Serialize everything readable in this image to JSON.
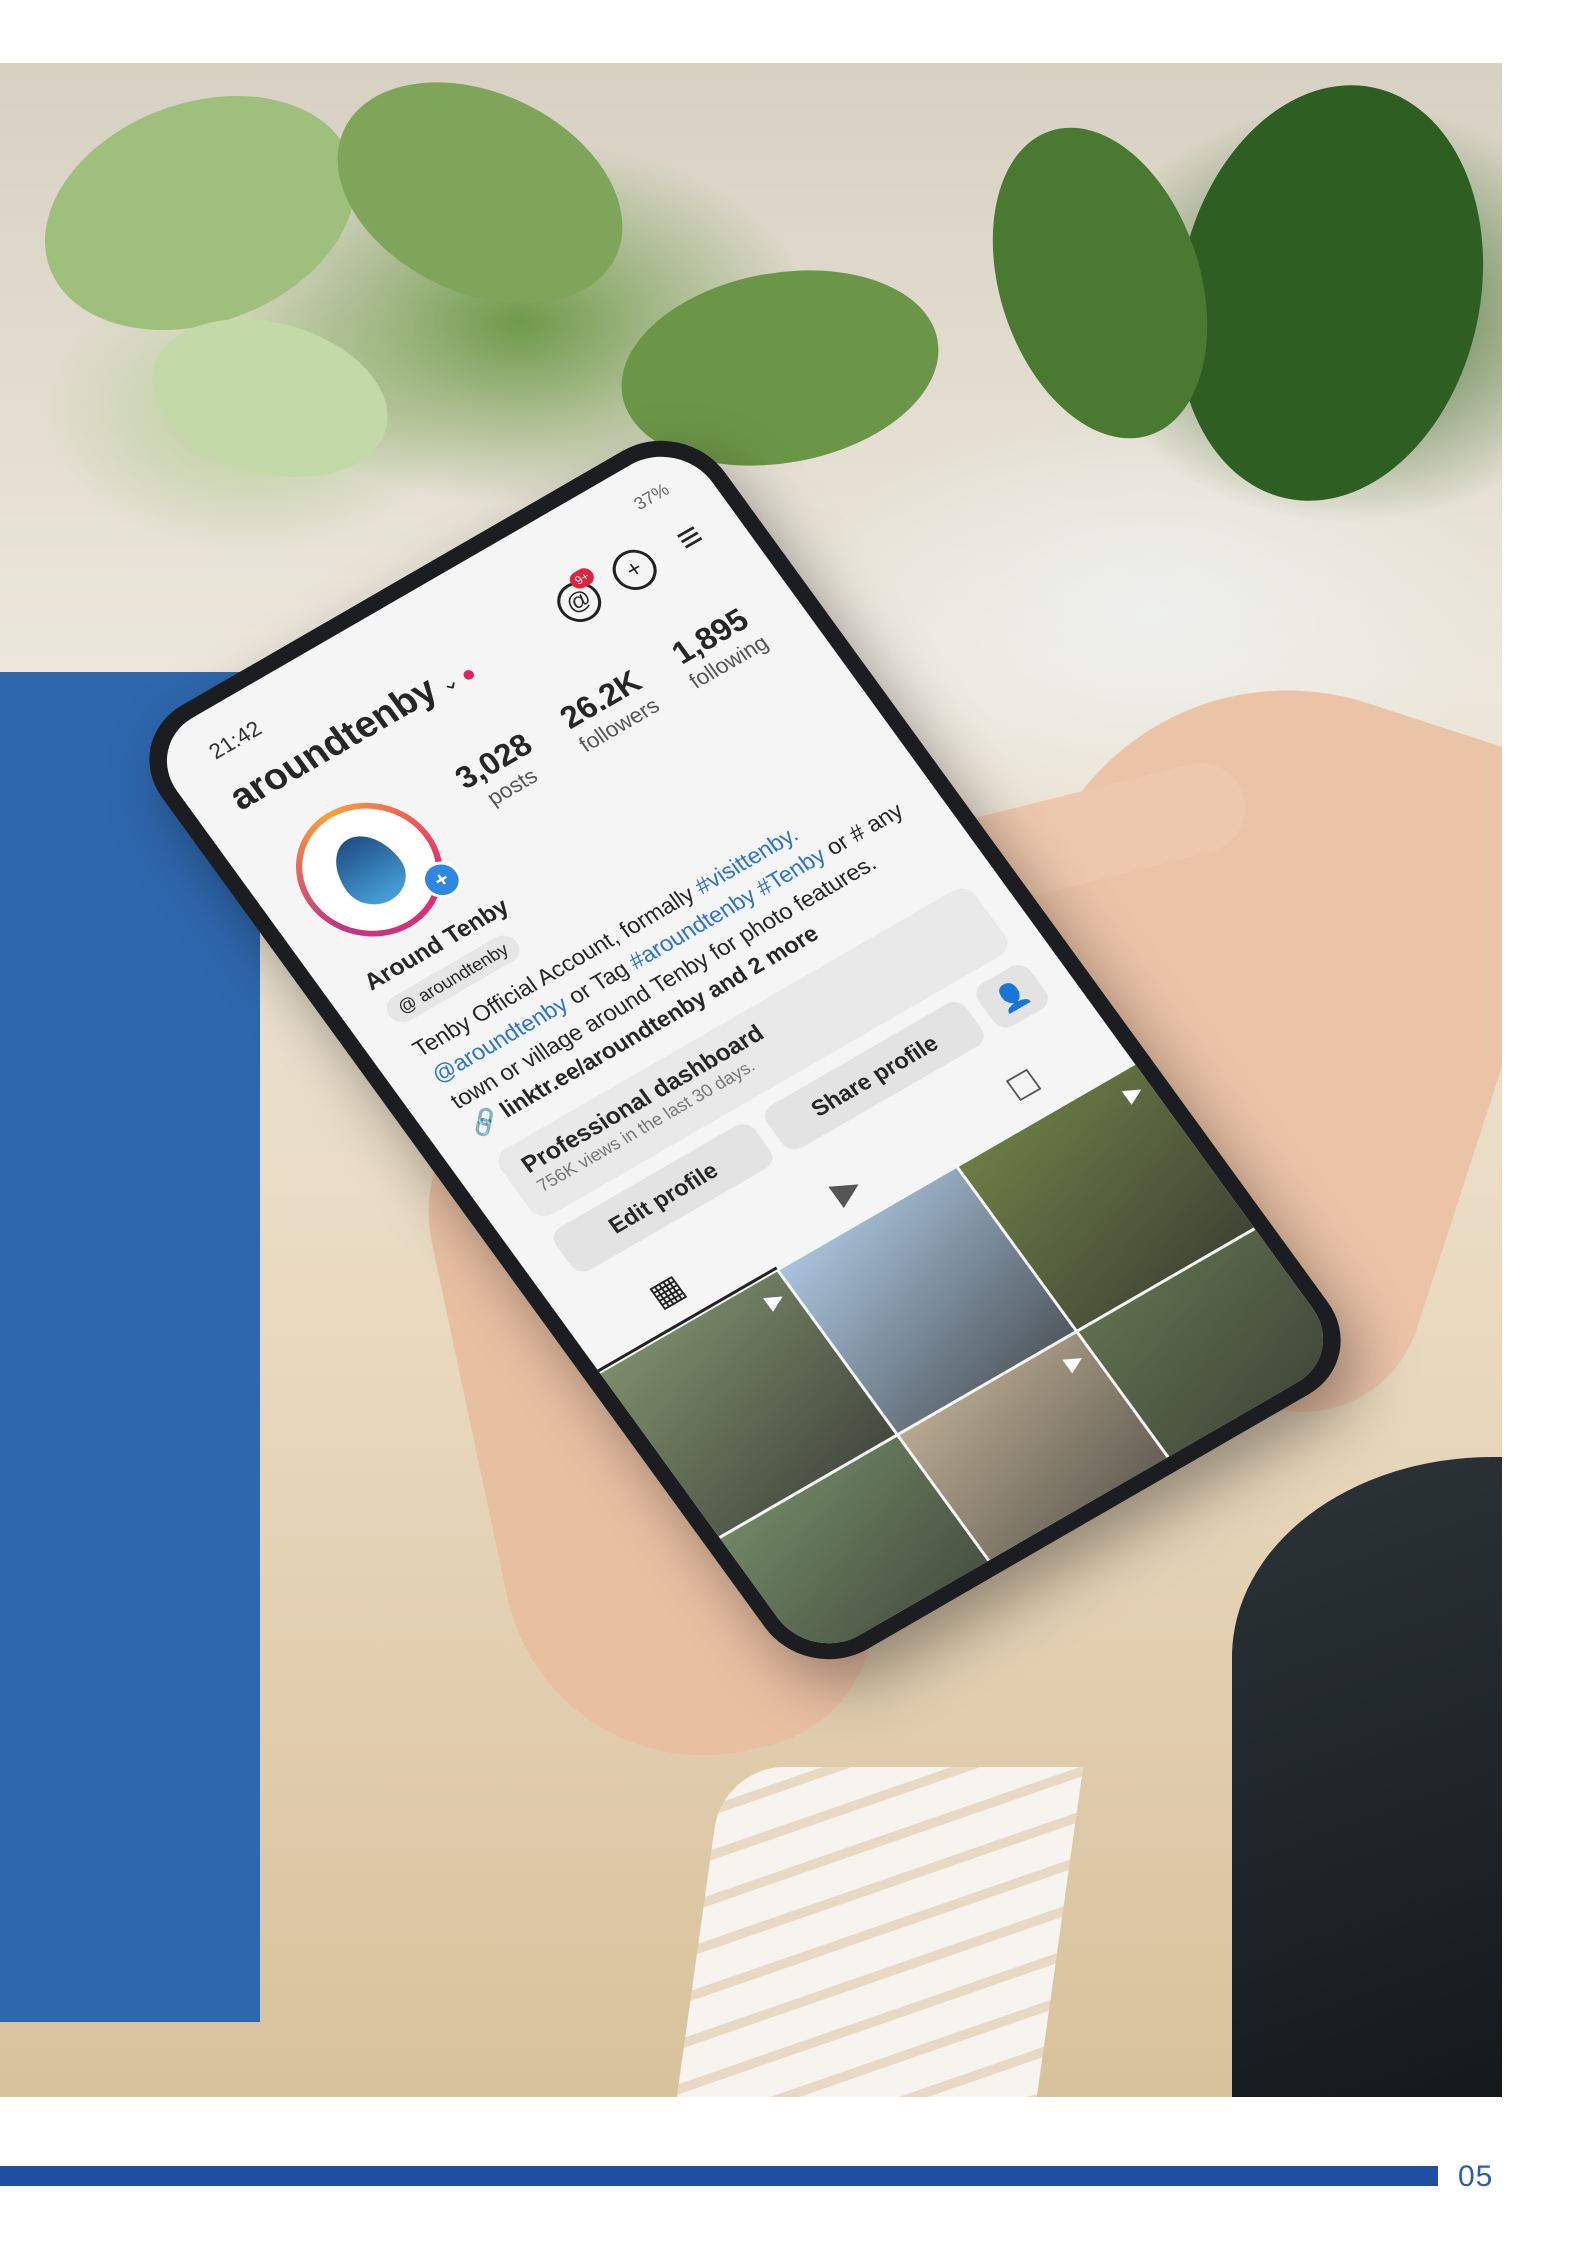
{
  "page": {
    "number": "05"
  },
  "phone": {
    "status": {
      "time": "21:42",
      "system": "37%"
    },
    "profile": {
      "username": "aroundtenby",
      "notification_badge": "9+",
      "display_name": "Around Tenby",
      "threads_handle": "aroundtenby",
      "stats": [
        {
          "value": "3,028",
          "label": "posts"
        },
        {
          "value": "26.2K",
          "label": "followers"
        },
        {
          "value": "1,895",
          "label": "following"
        }
      ],
      "bio": {
        "line1_text": "Tenby Official Account, formally ",
        "line1_tag": "#visittenby.",
        "line2_mention": "@aroundtenby",
        "line2_text": " or Tag ",
        "line2_tag1": "#aroundtenby",
        "line2_tag2": " #Tenby",
        "line2_end": " or # any",
        "line3": "town or village around Tenby for photo features.",
        "link": "linktr.ee/aroundtenby and 2 more"
      },
      "dashboard": {
        "title": "Professional dashboard",
        "subtitle": "756K views in the last 30 days."
      },
      "buttons": {
        "edit": "Edit profile",
        "share": "Share profile"
      }
    },
    "grid_colors": [
      [
        "#7c8d6a",
        "#a9c4dc",
        "#6c7d45"
      ],
      [
        "#6f8663",
        "#b7a98f",
        "#5e6f4d"
      ],
      [
        "#3c3346",
        "#9b7b5d",
        "#6a6d76"
      ],
      [
        "#c9c6c4",
        "#e59a4a",
        "#7fa0c0"
      ]
    ]
  },
  "colors": {
    "panel_blue": "#2e67ad",
    "rule_blue": "#1e4fa1",
    "page_num": "#2d5ea8"
  }
}
